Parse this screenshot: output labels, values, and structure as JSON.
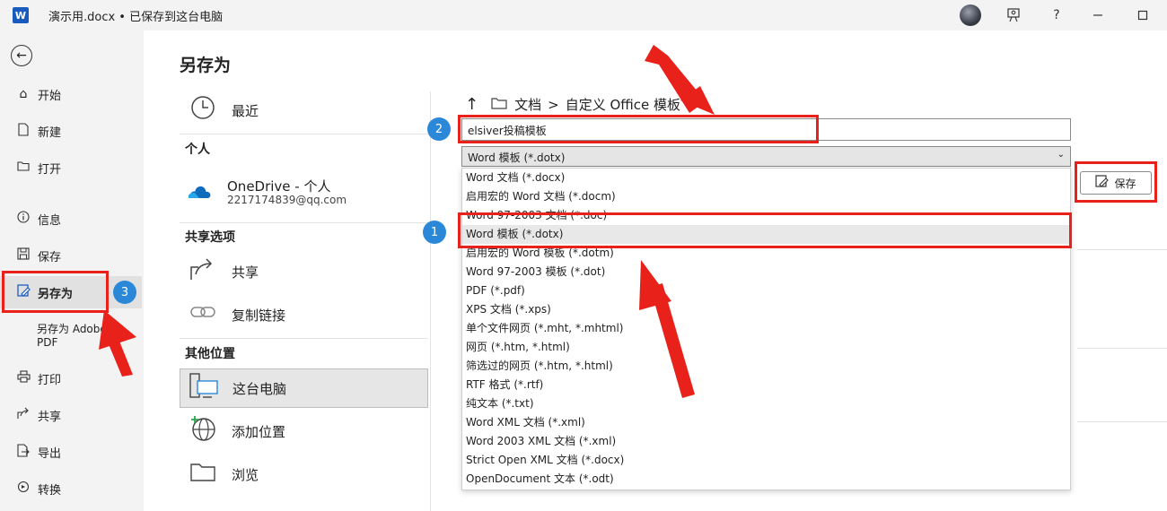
{
  "titlebar": {
    "app_icon": "W",
    "doc_title": "演示用.docx • 已保存到这台电脑",
    "icons": [
      "avatar",
      "person-feedback-icon",
      "help-icon",
      "minimize-icon",
      "maximize-icon"
    ],
    "help_label": "?"
  },
  "leftnav": {
    "items": [
      {
        "label": "开始",
        "icon": "home-icon"
      },
      {
        "label": "新建",
        "icon": "new-doc-icon"
      },
      {
        "label": "打开",
        "icon": "folder-open-icon"
      },
      {
        "label": "信息",
        "icon": "info-icon"
      },
      {
        "label": "保存",
        "icon": "save-icon"
      },
      {
        "label": "另存为",
        "icon": "save-as-icon"
      },
      {
        "label": "另存为 Adobe PDF",
        "icon": ""
      },
      {
        "label": "打印",
        "icon": "print-icon"
      },
      {
        "label": "共享",
        "icon": "share-icon"
      },
      {
        "label": "导出",
        "icon": "export-icon"
      },
      {
        "label": "转换",
        "icon": "convert-icon"
      }
    ]
  },
  "main": {
    "title": "另存为",
    "locations": {
      "recent": "最近",
      "personal_header": "个人",
      "onedrive_name": "OneDrive - 个人",
      "onedrive_email": "2217174839@qq.com",
      "shared_header": "共享选项",
      "share": "共享",
      "copy_link": "复制链接",
      "other_header": "其他位置",
      "this_pc": "这台电脑",
      "add_place": "添加位置",
      "browse": "浏览"
    },
    "breadcrumb": {
      "root": "文档",
      "sep": ">",
      "folder": "自定义 Office 模板"
    },
    "filename_value": "elsiver投稿模板",
    "filetype_selected": "Word 模板 (*.dotx)",
    "filetype_options": [
      "Word 文档 (*.docx)",
      "启用宏的 Word 文档 (*.docm)",
      "Word 97-2003 文档 (*.doc)",
      "Word 模板 (*.dotx)",
      "启用宏的 Word 模板 (*.dotm)",
      "Word 97-2003 模板 (*.dot)",
      "PDF (*.pdf)",
      "XPS 文档 (*.xps)",
      "单个文件网页 (*.mht, *.mhtml)",
      "网页 (*.htm, *.html)",
      "筛选过的网页 (*.htm, *.html)",
      "RTF 格式 (*.rtf)",
      "纯文本 (*.txt)",
      "Word XML 文档 (*.xml)",
      "Word 2003 XML 文档 (*.xml)",
      "Strict Open XML 文档 (*.docx)",
      "OpenDocument 文本 (*.odt)"
    ],
    "save_button": "保存"
  },
  "annotations": {
    "badge_1": "1",
    "badge_2": "2",
    "badge_3": "3",
    "highlight_color": "#e8211b",
    "badge_color": "#2b88d8"
  }
}
